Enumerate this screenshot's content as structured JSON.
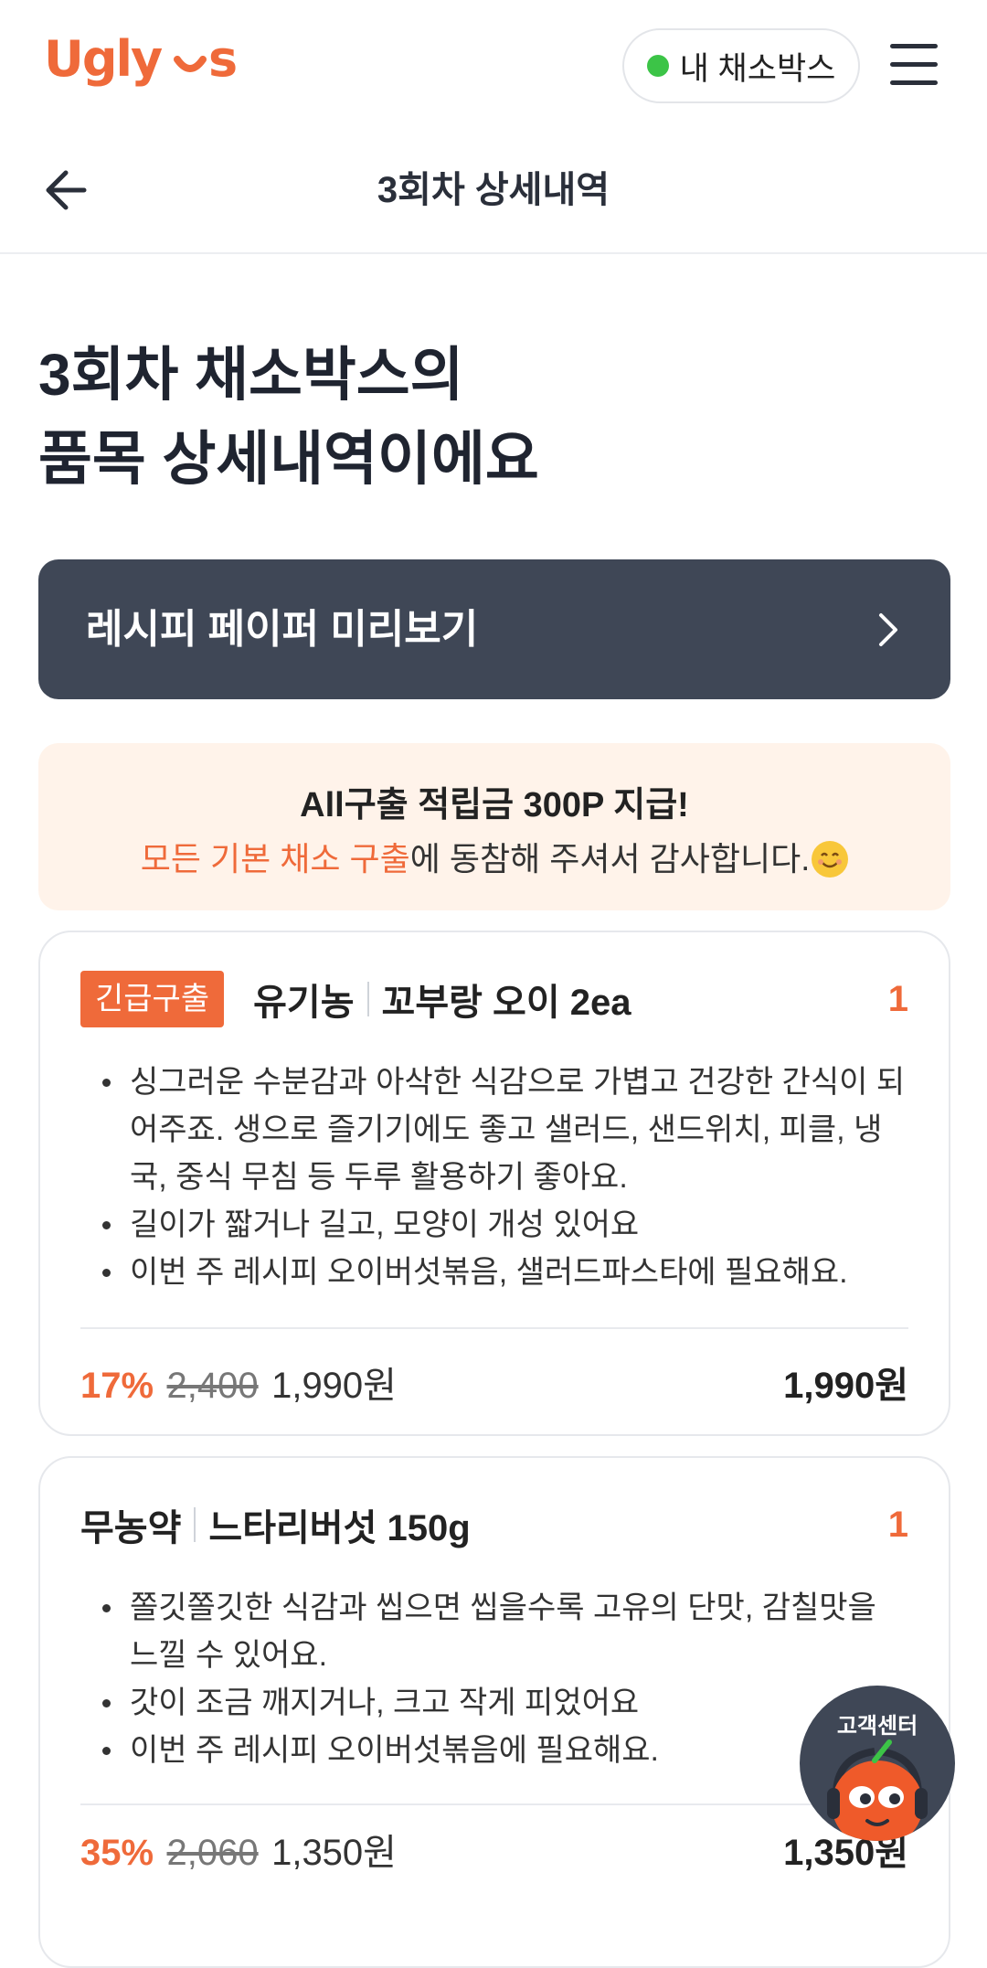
{
  "header": {
    "logo_text": "Ugly Us",
    "box_button_label": "내 채소박스",
    "status_color": "#3cc447"
  },
  "nav": {
    "title": "3회차 상세내역"
  },
  "heading": {
    "line1": "3회차 채소박스의",
    "line2": "품목 상세내역이에요"
  },
  "recipe_button": {
    "label": "레시피 페이퍼 미리보기"
  },
  "notice": {
    "title": "All구출 적립금 300P 지급!",
    "highlight": "모든 기본 채소 구출",
    "rest": "에 동참해 주셔서 감사합니다."
  },
  "items": [
    {
      "badge": "긴급구출",
      "type": "유기농",
      "name": "꼬부랑 오이 2ea",
      "quantity": "1",
      "description": [
        "싱그러운 수분감과 아삭한 식감으로 가볍고 건강한 간식이 되어주죠. 생으로 즐기기에도 좋고 샐러드, 샌드위치, 피클, 냉국, 중식 무침 등 두루 활용하기 좋아요.",
        "길이가 짧거나 길고, 모양이 개성 있어요",
        "이번 주 레시피 오이버섯볶음, 샐러드파스타에 필요해요."
      ],
      "discount": "17%",
      "original_price": "2,400",
      "sale_price": "1,990원",
      "total": "1,990원"
    },
    {
      "type": "무농약",
      "name": "느타리버섯 150g",
      "quantity": "1",
      "description": [
        "쫄깃쫄깃한 식감과 씹으면 씹을수록 고유의 단맛, 감칠맛을 느낄 수 있어요.",
        "갓이 조금 깨지거나, 크고 작게 피었어요",
        "이번 주 레시피 오이버섯볶음에 필요해요."
      ],
      "discount": "35%",
      "original_price": "2,060",
      "sale_price": "1,350원",
      "total": "1,350원"
    }
  ],
  "customer_center": {
    "label": "고객센터"
  },
  "colors": {
    "accent": "#ef6a3a",
    "dark_button": "#3f4756",
    "notice_bg": "#fff3ea"
  }
}
